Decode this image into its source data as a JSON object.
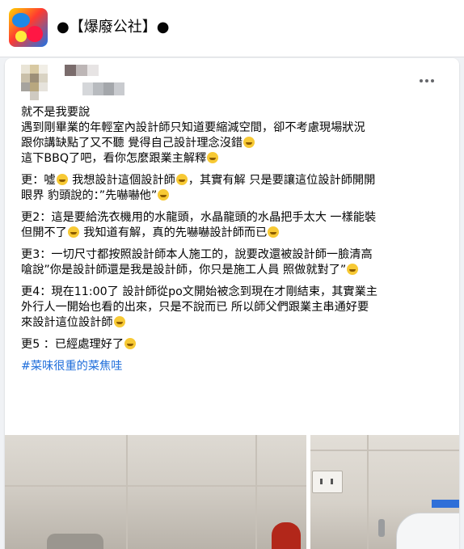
{
  "group": {
    "title": "●【爆廢公社】●",
    "logo_icon": "group-logo-icon"
  },
  "post": {
    "more_icon": "more-horizontal-icon",
    "paragraphs": [
      [
        "就不是我要說",
        "遇到剛畢業的年輕室內設計師只知道要縮減空間，卻不考慮現場狀況",
        "跟你講缺點了又不聽 覺得自己設計理念沒錯",
        "這下BBQ了吧，看你怎麼跟業主解釋"
      ],
      [
        "更：噓",
        " 我想設計這個設計師",
        "，其實有解 只是要讓這位設計師開開",
        "眼界  豹頭說的：”先嚇嚇他”"
      ],
      [
        "更2：這是要給洗衣機用的水龍頭，水晶龍頭的水晶把手太大 一樣能裝",
        "但開不了",
        "  我知道有解，真的先嚇嚇設計師而已"
      ],
      [
        "更3：一切尺寸都按照設計師本人施工的，說要改還被設計師一臉清高",
        "嗆說”你是設計師還是我是設計師，你只是施工人員  照做就對了”"
      ],
      [
        "更4：現在11:00了 設計師從po文開始被念到現在才剛結束，其實業主",
        "外行人一開始也看的出來，只是不說而已  所以師父們跟業主串通好要",
        "來設計這位設計師"
      ],
      [
        "更5  ：已經處理好了"
      ]
    ],
    "hashtag": "#菜味很重的菜焦哇",
    "emoji_icon": "laughing-emoji-icon"
  },
  "colors": {
    "hashtag": "#216fdb",
    "background": "#f0f2f5",
    "card": "#ffffff"
  }
}
